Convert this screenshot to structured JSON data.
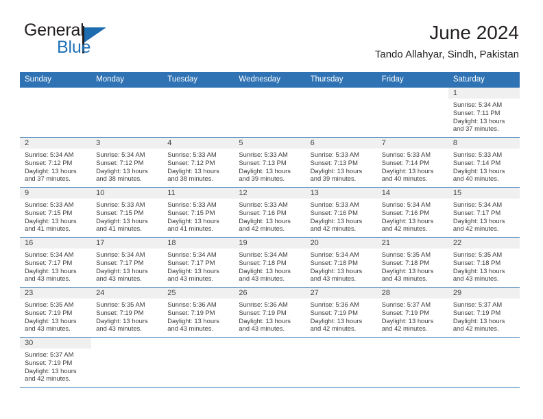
{
  "brand": {
    "word_one": "General",
    "word_two": "Blue",
    "accent_color": "#2072b8",
    "flag_icon": "triangle-flag-icon"
  },
  "header": {
    "title": "June 2024",
    "subtitle": "Tando Allahyar, Sindh, Pakistan"
  },
  "calendar": {
    "header_bg": "#2f73b4",
    "daynum_bg": "#f0f0f0",
    "columns": [
      "Sunday",
      "Monday",
      "Tuesday",
      "Wednesday",
      "Thursday",
      "Friday",
      "Saturday"
    ],
    "weeks": [
      [
        {
          "day": "",
          "blank": true
        },
        {
          "day": "",
          "blank": true
        },
        {
          "day": "",
          "blank": true
        },
        {
          "day": "",
          "blank": true
        },
        {
          "day": "",
          "blank": true
        },
        {
          "day": "",
          "blank": true
        },
        {
          "day": "1",
          "sunrise": "Sunrise: 5:34 AM",
          "sunset": "Sunset: 7:11 PM",
          "daylight1": "Daylight: 13 hours",
          "daylight2": "and 37 minutes."
        }
      ],
      [
        {
          "day": "2",
          "sunrise": "Sunrise: 5:34 AM",
          "sunset": "Sunset: 7:12 PM",
          "daylight1": "Daylight: 13 hours",
          "daylight2": "and 37 minutes."
        },
        {
          "day": "3",
          "sunrise": "Sunrise: 5:34 AM",
          "sunset": "Sunset: 7:12 PM",
          "daylight1": "Daylight: 13 hours",
          "daylight2": "and 38 minutes."
        },
        {
          "day": "4",
          "sunrise": "Sunrise: 5:33 AM",
          "sunset": "Sunset: 7:12 PM",
          "daylight1": "Daylight: 13 hours",
          "daylight2": "and 38 minutes."
        },
        {
          "day": "5",
          "sunrise": "Sunrise: 5:33 AM",
          "sunset": "Sunset: 7:13 PM",
          "daylight1": "Daylight: 13 hours",
          "daylight2": "and 39 minutes."
        },
        {
          "day": "6",
          "sunrise": "Sunrise: 5:33 AM",
          "sunset": "Sunset: 7:13 PM",
          "daylight1": "Daylight: 13 hours",
          "daylight2": "and 39 minutes."
        },
        {
          "day": "7",
          "sunrise": "Sunrise: 5:33 AM",
          "sunset": "Sunset: 7:14 PM",
          "daylight1": "Daylight: 13 hours",
          "daylight2": "and 40 minutes."
        },
        {
          "day": "8",
          "sunrise": "Sunrise: 5:33 AM",
          "sunset": "Sunset: 7:14 PM",
          "daylight1": "Daylight: 13 hours",
          "daylight2": "and 40 minutes."
        }
      ],
      [
        {
          "day": "9",
          "sunrise": "Sunrise: 5:33 AM",
          "sunset": "Sunset: 7:15 PM",
          "daylight1": "Daylight: 13 hours",
          "daylight2": "and 41 minutes."
        },
        {
          "day": "10",
          "sunrise": "Sunrise: 5:33 AM",
          "sunset": "Sunset: 7:15 PM",
          "daylight1": "Daylight: 13 hours",
          "daylight2": "and 41 minutes."
        },
        {
          "day": "11",
          "sunrise": "Sunrise: 5:33 AM",
          "sunset": "Sunset: 7:15 PM",
          "daylight1": "Daylight: 13 hours",
          "daylight2": "and 41 minutes."
        },
        {
          "day": "12",
          "sunrise": "Sunrise: 5:33 AM",
          "sunset": "Sunset: 7:16 PM",
          "daylight1": "Daylight: 13 hours",
          "daylight2": "and 42 minutes."
        },
        {
          "day": "13",
          "sunrise": "Sunrise: 5:33 AM",
          "sunset": "Sunset: 7:16 PM",
          "daylight1": "Daylight: 13 hours",
          "daylight2": "and 42 minutes."
        },
        {
          "day": "14",
          "sunrise": "Sunrise: 5:34 AM",
          "sunset": "Sunset: 7:16 PM",
          "daylight1": "Daylight: 13 hours",
          "daylight2": "and 42 minutes."
        },
        {
          "day": "15",
          "sunrise": "Sunrise: 5:34 AM",
          "sunset": "Sunset: 7:17 PM",
          "daylight1": "Daylight: 13 hours",
          "daylight2": "and 42 minutes."
        }
      ],
      [
        {
          "day": "16",
          "sunrise": "Sunrise: 5:34 AM",
          "sunset": "Sunset: 7:17 PM",
          "daylight1": "Daylight: 13 hours",
          "daylight2": "and 43 minutes."
        },
        {
          "day": "17",
          "sunrise": "Sunrise: 5:34 AM",
          "sunset": "Sunset: 7:17 PM",
          "daylight1": "Daylight: 13 hours",
          "daylight2": "and 43 minutes."
        },
        {
          "day": "18",
          "sunrise": "Sunrise: 5:34 AM",
          "sunset": "Sunset: 7:17 PM",
          "daylight1": "Daylight: 13 hours",
          "daylight2": "and 43 minutes."
        },
        {
          "day": "19",
          "sunrise": "Sunrise: 5:34 AM",
          "sunset": "Sunset: 7:18 PM",
          "daylight1": "Daylight: 13 hours",
          "daylight2": "and 43 minutes."
        },
        {
          "day": "20",
          "sunrise": "Sunrise: 5:34 AM",
          "sunset": "Sunset: 7:18 PM",
          "daylight1": "Daylight: 13 hours",
          "daylight2": "and 43 minutes."
        },
        {
          "day": "21",
          "sunrise": "Sunrise: 5:35 AM",
          "sunset": "Sunset: 7:18 PM",
          "daylight1": "Daylight: 13 hours",
          "daylight2": "and 43 minutes."
        },
        {
          "day": "22",
          "sunrise": "Sunrise: 5:35 AM",
          "sunset": "Sunset: 7:18 PM",
          "daylight1": "Daylight: 13 hours",
          "daylight2": "and 43 minutes."
        }
      ],
      [
        {
          "day": "23",
          "sunrise": "Sunrise: 5:35 AM",
          "sunset": "Sunset: 7:19 PM",
          "daylight1": "Daylight: 13 hours",
          "daylight2": "and 43 minutes."
        },
        {
          "day": "24",
          "sunrise": "Sunrise: 5:35 AM",
          "sunset": "Sunset: 7:19 PM",
          "daylight1": "Daylight: 13 hours",
          "daylight2": "and 43 minutes."
        },
        {
          "day": "25",
          "sunrise": "Sunrise: 5:36 AM",
          "sunset": "Sunset: 7:19 PM",
          "daylight1": "Daylight: 13 hours",
          "daylight2": "and 43 minutes."
        },
        {
          "day": "26",
          "sunrise": "Sunrise: 5:36 AM",
          "sunset": "Sunset: 7:19 PM",
          "daylight1": "Daylight: 13 hours",
          "daylight2": "and 43 minutes."
        },
        {
          "day": "27",
          "sunrise": "Sunrise: 5:36 AM",
          "sunset": "Sunset: 7:19 PM",
          "daylight1": "Daylight: 13 hours",
          "daylight2": "and 42 minutes."
        },
        {
          "day": "28",
          "sunrise": "Sunrise: 5:37 AM",
          "sunset": "Sunset: 7:19 PM",
          "daylight1": "Daylight: 13 hours",
          "daylight2": "and 42 minutes."
        },
        {
          "day": "29",
          "sunrise": "Sunrise: 5:37 AM",
          "sunset": "Sunset: 7:19 PM",
          "daylight1": "Daylight: 13 hours",
          "daylight2": "and 42 minutes."
        }
      ],
      [
        {
          "day": "30",
          "sunrise": "Sunrise: 5:37 AM",
          "sunset": "Sunset: 7:19 PM",
          "daylight1": "Daylight: 13 hours",
          "daylight2": "and 42 minutes."
        },
        {
          "day": "",
          "blank": true
        },
        {
          "day": "",
          "blank": true
        },
        {
          "day": "",
          "blank": true
        },
        {
          "day": "",
          "blank": true
        },
        {
          "day": "",
          "blank": true
        },
        {
          "day": "",
          "blank": true
        }
      ]
    ]
  }
}
